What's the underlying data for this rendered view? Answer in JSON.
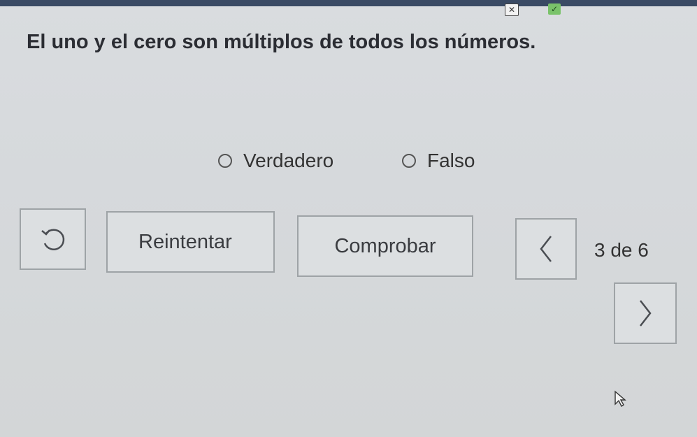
{
  "header": {
    "wrong_icon": "x-mark-icon",
    "correct_icon": "check-mark-icon"
  },
  "question": {
    "text": "El uno y el cero son múltiplos de todos los números."
  },
  "options": [
    {
      "label": "Verdadero"
    },
    {
      "label": "Falso"
    }
  ],
  "buttons": {
    "reset_icon": "undo-icon",
    "retry_label": "Reintentar",
    "check_label": "Comprobar",
    "prev_icon": "chevron-left-icon",
    "next_icon": "chevron-right-icon"
  },
  "pager": {
    "text": "3 de 6"
  },
  "colors": {
    "accent_dark": "#3a4a64",
    "correct_green": "#7ac36a"
  }
}
